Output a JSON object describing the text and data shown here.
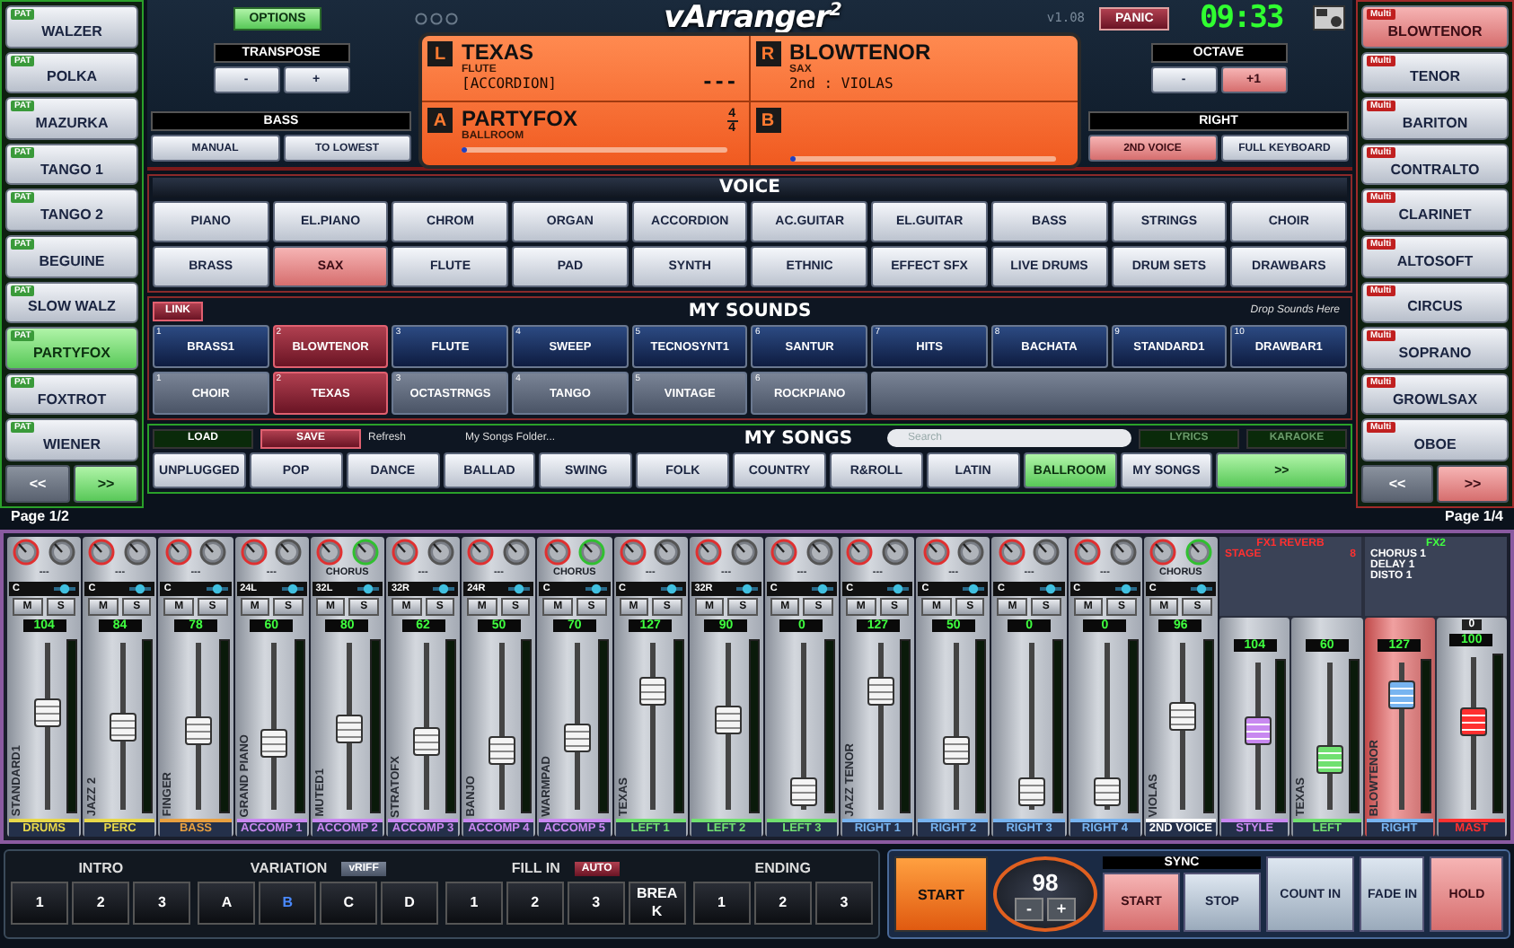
{
  "styles": {
    "items": [
      {
        "label": "WALZER",
        "badge": "PAT",
        "selected": false
      },
      {
        "label": "POLKA",
        "badge": "PAT",
        "selected": false
      },
      {
        "label": "MAZURKA",
        "badge": "PAT",
        "selected": false
      },
      {
        "label": "TANGO 1",
        "badge": "PAT",
        "selected": false
      },
      {
        "label": "TANGO 2",
        "badge": "PAT",
        "selected": false
      },
      {
        "label": "BEGUINE",
        "badge": "PAT",
        "selected": false
      },
      {
        "label": "SLOW WALZ",
        "badge": "PAT",
        "selected": false
      },
      {
        "label": "PARTYFOX",
        "badge": "PAT",
        "selected": true
      },
      {
        "label": "FOXTROT",
        "badge": "PAT",
        "selected": false
      },
      {
        "label": "WIENER",
        "badge": "PAT",
        "selected": false
      }
    ],
    "prev": "<<",
    "next": ">>",
    "page": "Page 1/2"
  },
  "header": {
    "options": "OPTIONS",
    "title": "vArranger$^{2}$",
    "version": "v1.08",
    "panic": "PANIC",
    "clock": "09:33"
  },
  "transpose": {
    "title": "TRANSPOSE",
    "buttons": [
      "-",
      "+"
    ]
  },
  "bass": {
    "title": "BASS",
    "buttons": [
      {
        "label": "MANUAL",
        "selected": false
      },
      {
        "label": "TO LOWEST",
        "selected": false
      }
    ]
  },
  "display": {
    "parts": [
      {
        "key": "L",
        "name": "TEXAS",
        "line1": "FLUTE",
        "line2": "[ACCORDION]",
        "extra": "---"
      },
      {
        "key": "R",
        "name": "BLOWTENOR",
        "line1": "SAX",
        "line2": "2nd : VIOLAS"
      }
    ],
    "style": {
      "key": "A",
      "name": "PARTYFOX",
      "category": "BALLROOM",
      "numerator": "4",
      "denominator": "4",
      "level": 0.02
    },
    "next_style": {
      "key": "B",
      "level": 0.02
    }
  },
  "octave": {
    "title": "OCTAVE",
    "buttons": [
      {
        "label": "-",
        "selected": false
      },
      {
        "label": "+1",
        "selected": true
      }
    ]
  },
  "right": {
    "title": "RIGHT",
    "buttons": [
      {
        "label": "2ND VOICE",
        "selected": true
      },
      {
        "label": "FULL KEYBOARD",
        "selected": false
      }
    ]
  },
  "voice": {
    "title": "VOICE",
    "buttons": [
      {
        "label": "PIANO",
        "selected": false
      },
      {
        "label": "EL.PIANO",
        "selected": false
      },
      {
        "label": "CHROM",
        "selected": false
      },
      {
        "label": "ORGAN",
        "selected": false
      },
      {
        "label": "ACCORDION",
        "selected": false
      },
      {
        "label": "AC.GUITAR",
        "selected": false
      },
      {
        "label": "EL.GUITAR",
        "selected": false
      },
      {
        "label": "BASS",
        "selected": false
      },
      {
        "label": "STRINGS",
        "selected": false
      },
      {
        "label": "CHOIR",
        "selected": false
      },
      {
        "label": "BRASS",
        "selected": false
      },
      {
        "label": "SAX",
        "selected": true
      },
      {
        "label": "FLUTE",
        "selected": false
      },
      {
        "label": "PAD",
        "selected": false
      },
      {
        "label": "SYNTH",
        "selected": false
      },
      {
        "label": "ETHNIC",
        "selected": false
      },
      {
        "label": "EFFECT SFX",
        "selected": false
      },
      {
        "label": "LIVE DRUMS",
        "selected": false
      },
      {
        "label": "DRUM SETS",
        "selected": false
      },
      {
        "label": "DRAWBARS",
        "selected": false
      }
    ]
  },
  "my_sounds": {
    "link": "LINK",
    "title": "MY SOUNDS",
    "hint": "Drop Sounds Here",
    "rows": [
      {
        "kind": "right",
        "items": [
          {
            "index": "1",
            "label": "BRASS1",
            "selected": false
          },
          {
            "index": "2",
            "label": "BLOWTENOR",
            "selected": true
          },
          {
            "index": "3",
            "label": "FLUTE",
            "selected": false
          },
          {
            "index": "4",
            "label": "SWEEP",
            "selected": false
          },
          {
            "index": "5",
            "label": "TECNOSYNT1",
            "selected": false
          },
          {
            "index": "6",
            "label": "SANTUR",
            "selected": false
          },
          {
            "index": "7",
            "label": "HITS",
            "selected": false
          },
          {
            "index": "8",
            "label": "BACHATA",
            "selected": false
          },
          {
            "index": "9",
            "label": "STANDARD1",
            "selected": false
          },
          {
            "index": "10",
            "label": "DRAWBAR1",
            "selected": false
          }
        ]
      },
      {
        "kind": "left",
        "items": [
          {
            "index": "1",
            "label": "CHOIR",
            "selected": false
          },
          {
            "index": "2",
            "label": "TEXAS",
            "selected": true
          },
          {
            "index": "3",
            "label": "OCTASTRNGS",
            "selected": false
          },
          {
            "index": "4",
            "label": "TANGO",
            "selected": false
          },
          {
            "index": "5",
            "label": "VINTAGE",
            "selected": false
          },
          {
            "index": "6",
            "label": "ROCKPIANO",
            "selected": false
          }
        ]
      }
    ]
  },
  "my_songs": {
    "load": "LOAD",
    "save": "SAVE",
    "refresh": "Refresh",
    "folder": "My Songs Folder...",
    "title": "MY SONGS",
    "search_placeholder": "Search",
    "lyrics": "LYRICS",
    "karaoke": "KARAOKE",
    "next": ">>",
    "categories": [
      {
        "label": "UNPLUGGED",
        "selected": false
      },
      {
        "label": "POP",
        "selected": false
      },
      {
        "label": "DANCE",
        "selected": false
      },
      {
        "label": "BALLAD",
        "selected": false
      },
      {
        "label": "SWING",
        "selected": false
      },
      {
        "label": "FOLK",
        "selected": false
      },
      {
        "label": "COUNTRY",
        "selected": false
      },
      {
        "label": "R&ROLL",
        "selected": false
      },
      {
        "label": "LATIN",
        "selected": false
      },
      {
        "label": "BALLROOM",
        "selected": true
      },
      {
        "label": "MY SONGS",
        "selected": false
      }
    ]
  },
  "voices": {
    "items": [
      {
        "label": "BLOWTENOR",
        "badge": "Multi",
        "selected": true
      },
      {
        "label": "TENOR",
        "badge": "Multi",
        "selected": false
      },
      {
        "label": "BARITON",
        "badge": "Multi",
        "selected": false
      },
      {
        "label": "CONTRALTO",
        "badge": "Multi",
        "selected": false
      },
      {
        "label": "CLARINET",
        "badge": "Multi",
        "selected": false
      },
      {
        "label": "ALTOSOFT",
        "badge": "Multi",
        "selected": false
      },
      {
        "label": "CIRCUS",
        "badge": "Multi",
        "selected": false
      },
      {
        "label": "SOPRANO",
        "badge": "Multi",
        "selected": false
      },
      {
        "label": "GROWLSAX",
        "badge": "Multi",
        "selected": false
      },
      {
        "label": "OBOE",
        "badge": "Multi",
        "selected": false
      }
    ],
    "prev": "<<",
    "next": ">>",
    "page": "Page 1/4"
  },
  "mixer": {
    "channels": [
      {
        "name": "STANDARD1",
        "group": "DRUMS",
        "color": "#e8d84a",
        "value": "104",
        "level": 0.6,
        "fx": "---",
        "pan": "C",
        "mute": "M",
        "solo": "S"
      },
      {
        "name": "JAZZ 2",
        "group": "PERC",
        "color": "#e8d84a",
        "value": "84",
        "level": 0.5,
        "fx": "---",
        "pan": "C",
        "mute": "M",
        "solo": "S"
      },
      {
        "name": "FINGER",
        "group": "BASS",
        "color": "#e8a040",
        "value": "78",
        "level": 0.47,
        "fx": "---",
        "pan": "C",
        "mute": "M",
        "solo": "S"
      },
      {
        "name": "GRAND PIANO",
        "group": "ACCOMP 1",
        "color": "#c888f0",
        "value": "60",
        "level": 0.38,
        "fx": "---",
        "pan": "24L",
        "mute": "M",
        "solo": "S"
      },
      {
        "name": "MUTED1",
        "group": "ACCOMP 2",
        "color": "#c888f0",
        "value": "80",
        "level": 0.48,
        "fx": "CHORUS",
        "pan": "32L",
        "mute": "M",
        "solo": "S"
      },
      {
        "name": "STRATOFX",
        "group": "ACCOMP 3",
        "color": "#c888f0",
        "value": "62",
        "level": 0.39,
        "fx": "---",
        "pan": "32R",
        "mute": "M",
        "solo": "S"
      },
      {
        "name": "BANJO",
        "group": "ACCOMP 4",
        "color": "#c888f0",
        "value": "50",
        "level": 0.32,
        "fx": "---",
        "pan": "24R",
        "mute": "M",
        "solo": "S"
      },
      {
        "name": "WARMPAD",
        "group": "ACCOMP 5",
        "color": "#c888f0",
        "value": "70",
        "level": 0.42,
        "fx": "CHORUS",
        "pan": "C",
        "mute": "M",
        "solo": "S"
      },
      {
        "name": "TEXAS",
        "group": "LEFT 1",
        "color": "#70e070",
        "value": "127",
        "level": 0.75,
        "fx": "---",
        "pan": "C",
        "mute": "M",
        "solo": "S"
      },
      {
        "group": "LEFT 2",
        "color": "#70e070",
        "value": "90",
        "level": 0.55,
        "fx": "---",
        "pan": "32R",
        "mute": "M",
        "solo": "S"
      },
      {
        "group": "LEFT 3",
        "color": "#70e070",
        "value": "0",
        "level": 0.02,
        "fx": "---",
        "pan": "C",
        "mute": "M",
        "solo": "S"
      },
      {
        "name": "JAZZ TENOR",
        "group": "RIGHT 1",
        "color": "#78b4f0",
        "value": "127",
        "level": 0.75,
        "fx": "---",
        "pan": "C",
        "mute": "M",
        "solo": "S"
      },
      {
        "group": "RIGHT 2",
        "color": "#78b4f0",
        "value": "50",
        "level": 0.32,
        "fx": "---",
        "pan": "C",
        "mute": "M",
        "solo": "S"
      },
      {
        "group": "RIGHT 3",
        "color": "#78b4f0",
        "value": "0",
        "level": 0.02,
        "fx": "---",
        "pan": "C",
        "mute": "M",
        "solo": "S"
      },
      {
        "group": "RIGHT 4",
        "color": "#78b4f0",
        "value": "0",
        "level": 0.02,
        "fx": "---",
        "pan": "C",
        "mute": "M",
        "solo": "S"
      },
      {
        "name": "VIOLAS",
        "group": "2ND VOICE",
        "color": "#ffffff",
        "value": "96",
        "level": 0.57,
        "fx": "CHORUS",
        "pan": "C",
        "mute": "M",
        "solo": "S"
      }
    ],
    "fx1": {
      "title": "FX1 REVERB",
      "preset": "STAGE",
      "number": "8"
    },
    "fx2": {
      "title": "FX2",
      "items": [
        "CHORUS 1",
        "DELAY 1",
        "DISTO 1"
      ]
    },
    "master": [
      {
        "group": "STYLE",
        "color": "#c888f0",
        "value": "104",
        "level": 0.55
      },
      {
        "name": "TEXAS",
        "group": "LEFT",
        "color": "#70e070",
        "value": "60",
        "level": 0.3
      },
      {
        "name": "BLOWTENOR",
        "group": "RIGHT",
        "color": "#78b4f0",
        "value": "127",
        "level": 0.85
      },
      {
        "group": "MAST",
        "color": "#ff3030",
        "value": "100",
        "level": 0.6,
        "peak": "0"
      }
    ]
  },
  "transport": {
    "intro": {
      "title": "INTRO",
      "buttons": [
        {
          "label": "1",
          "selected": false
        },
        {
          "label": "2",
          "selected": false
        },
        {
          "label": "3",
          "selected": false
        }
      ]
    },
    "variation": {
      "title": "VARIATION",
      "tag": "vRIFF",
      "buttons": [
        {
          "label": "A",
          "selected": false
        },
        {
          "label": "B",
          "selected": true
        },
        {
          "label": "C",
          "selected": false
        },
        {
          "label": "D",
          "selected": false
        }
      ]
    },
    "fill_in": {
      "title": "FILL IN",
      "tag": "AUTO",
      "buttons": [
        {
          "label": "1",
          "selected": false
        },
        {
          "label": "2",
          "selected": false
        },
        {
          "label": "3",
          "selected": false
        },
        {
          "label": "BREAK",
          "selected": false
        }
      ]
    },
    "ending": {
      "title": "ENDING",
      "buttons": [
        {
          "label": "1",
          "selected": false
        },
        {
          "label": "2",
          "selected": false
        },
        {
          "label": "3",
          "selected": false
        }
      ]
    },
    "start": "START",
    "tempo": {
      "value": "98",
      "minus": "-",
      "plus": "+"
    },
    "sync": {
      "title": "SYNC",
      "start": "START",
      "stop": "STOP"
    },
    "count_in": "COUNT IN",
    "fade_in": "FADE IN",
    "hold": "HOLD"
  }
}
